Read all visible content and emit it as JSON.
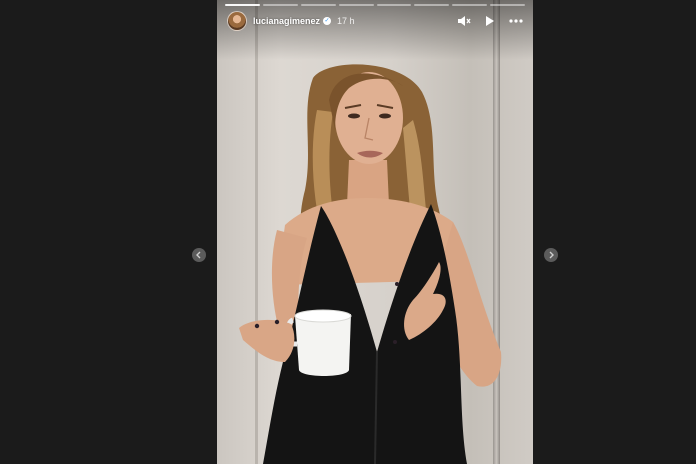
{
  "story": {
    "username": "lucianagimenez",
    "time": "17 h",
    "segments_total": 8,
    "segments_active": 1
  },
  "icons": {
    "verified": "verified-badge-icon",
    "mute": "muted-speaker-icon",
    "play": "play-icon",
    "more": "more-options-icon",
    "prev": "chevron-left-icon",
    "next": "chevron-right-icon"
  },
  "colors": {
    "background": "#1b1b1b",
    "verified": "#3897f0"
  }
}
